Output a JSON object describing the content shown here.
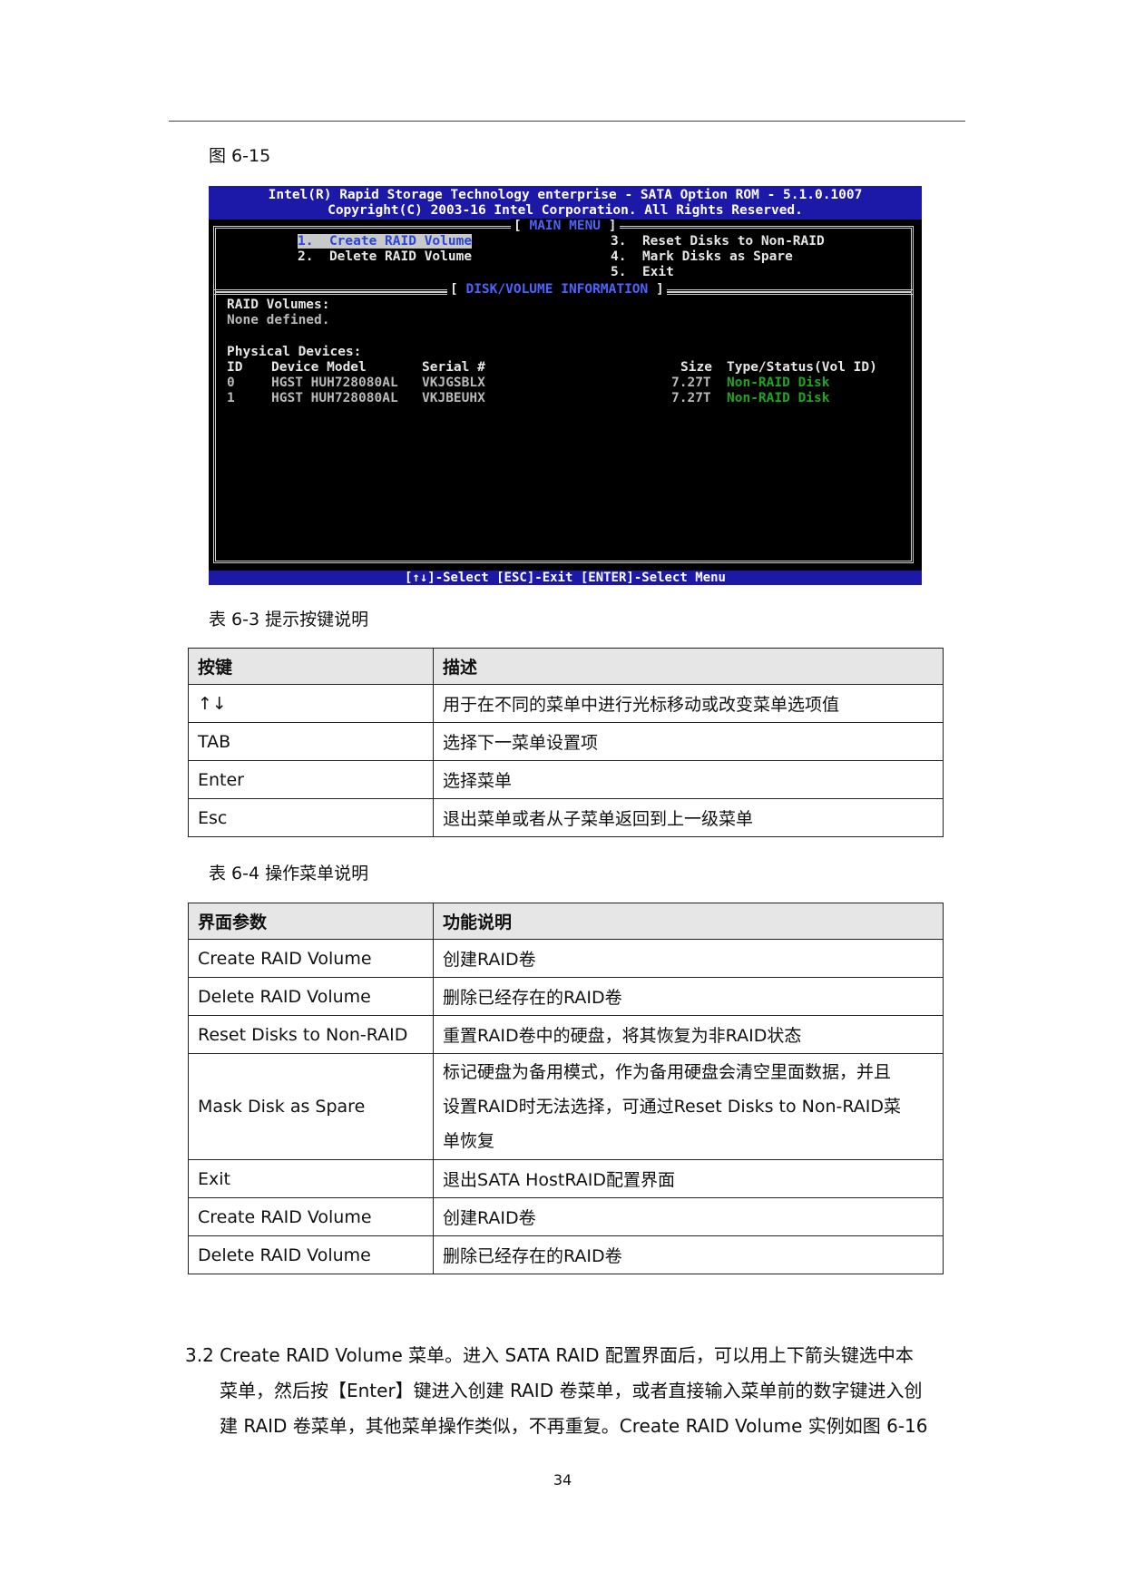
{
  "figure_caption": "图 6-15",
  "bios": {
    "header_line1": "Intel(R) Rapid Storage Technology enterprise - SATA Option ROM - 5.1.0.1007",
    "header_line2": "Copyright(C) 2003-16 Intel Corporation.  All Rights Reserved.",
    "main_menu_title": "MAIN MENU",
    "menu_items": [
      {
        "num": "1.",
        "label": "Create RAID Volume"
      },
      {
        "num": "2.",
        "label": "Delete RAID Volume"
      },
      {
        "num": "3.",
        "label": "Reset Disks to Non-RAID"
      },
      {
        "num": "4.",
        "label": "Mark Disks as Spare"
      },
      {
        "num": "5.",
        "label": "Exit"
      }
    ],
    "info_title": "DISK/VOLUME INFORMATION",
    "raid_volumes_label": "RAID Volumes:",
    "raid_volumes_value": "None defined.",
    "physical_devices_label": "Physical Devices:",
    "columns": {
      "id": "ID",
      "model": "Device Model",
      "serial": "Serial #",
      "size": "Size",
      "type": "Type/Status(Vol ID)"
    },
    "devices": [
      {
        "id": "0",
        "model": "HGST HUH728080AL",
        "serial": "VKJGSBLX",
        "size": "7.27T",
        "type": "Non-RAID Disk"
      },
      {
        "id": "1",
        "model": "HGST HUH728080AL",
        "serial": "VKJBEUHX",
        "size": "7.27T",
        "type": "Non-RAID Disk"
      }
    ],
    "footer": "[↑↓]-Select    [ESC]-Exit    [ENTER]-Select Menu",
    "colors": {
      "header_bg": "#1c18a8",
      "screen_bg": "#000000",
      "status_green": "#1fa51f",
      "title_blue": "#4c63ff"
    }
  },
  "table1": {
    "caption": "表 6-3  提示按键说明",
    "headers": [
      "按键",
      "描述"
    ],
    "rows": [
      [
        "↑↓",
        "用于在不同的菜单中进行光标移动或改变菜单选项值"
      ],
      [
        "TAB",
        "选择下一菜单设置项"
      ],
      [
        "Enter",
        "选择菜单"
      ],
      [
        "Esc",
        "退出菜单或者从子菜单返回到上一级菜单"
      ]
    ]
  },
  "table2": {
    "caption": "表 6-4  操作菜单说明",
    "headers": [
      "界面参数",
      "功能说明"
    ],
    "rows": [
      [
        "Create RAID Volume",
        "创建RAID卷"
      ],
      [
        "Delete RAID Volume",
        "删除已经存在的RAID卷"
      ],
      [
        "Reset Disks to Non-RAID",
        "重置RAID卷中的硬盘，将其恢复为非RAID状态"
      ],
      [
        "Mask Disk as Spare",
        "标记硬盘为备用模式，作为备用硬盘会清空里面数据，并且设置RAID时无法选择，可通过Reset Disks to Non-RAID菜单恢复"
      ],
      [
        "Exit",
        "退出SATA HostRAID配置界面"
      ],
      [
        "Create RAID Volume",
        "创建RAID卷"
      ],
      [
        "Delete RAID Volume",
        "删除已经存在的RAID卷"
      ]
    ],
    "multiline_lines": [
      "标记硬盘为备用模式，作为备用硬盘会清空里面数据，并且",
      "设置RAID时无法选择，可通过Reset Disks to Non-RAID菜",
      "单恢复"
    ]
  },
  "paragraph": {
    "line1": "3.2 Create RAID Volume 菜单。进入 SATA RAID 配置界面后，可以用上下箭头键选中本",
    "line2": "菜单，然后按【Enter】键进入创建 RAID 卷菜单，或者直接输入菜单前的数字键进入创",
    "line3": "建 RAID 卷菜单，其他菜单操作类似，不再重复。Create RAID Volume 实例如图 6-16"
  },
  "page_number": "34"
}
